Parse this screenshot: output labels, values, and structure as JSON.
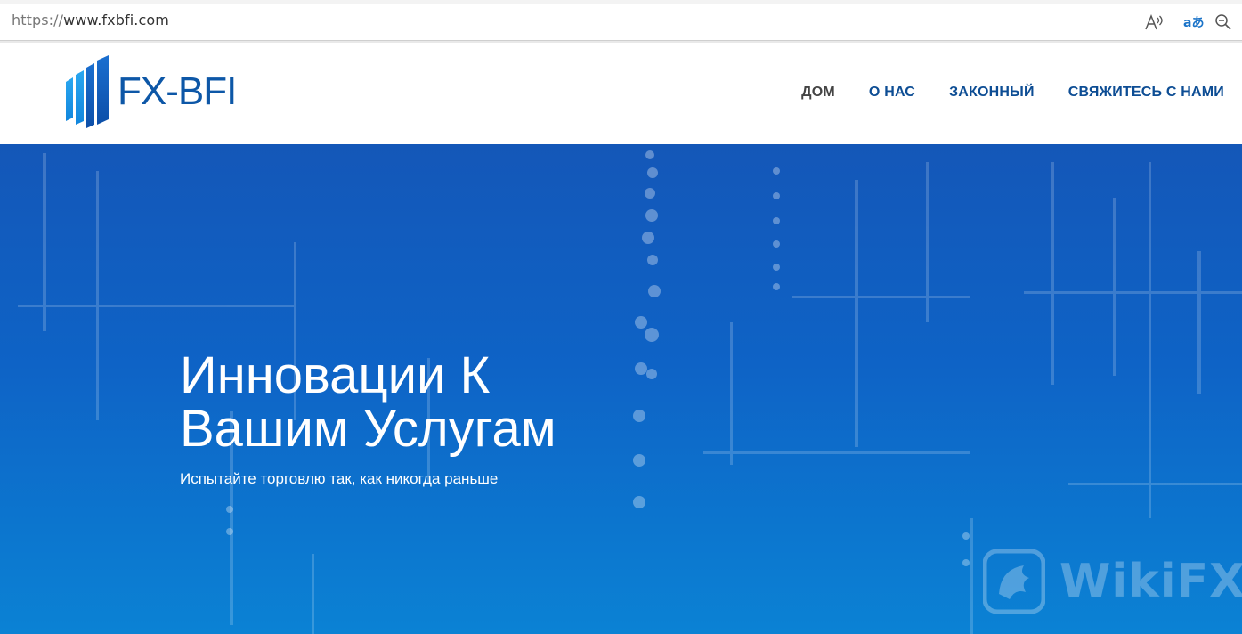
{
  "browser": {
    "url_scheme": "https://",
    "url_host": "www.fxbfi.com",
    "icons": [
      "read-aloud-icon",
      "translate-icon",
      "zoom-out-icon"
    ]
  },
  "header": {
    "logo_text": "FX-BFI",
    "nav": [
      {
        "label": "ДОМ",
        "active": true
      },
      {
        "label": "О НАС"
      },
      {
        "label": "ЗАКОННЫЙ"
      },
      {
        "label": "СВЯЖИТЕСЬ С НАМИ"
      }
    ]
  },
  "hero": {
    "title_line1": "Инновации К",
    "title_line2": "Вашим Услугам",
    "subtitle": "Испытайте торговлю так, как никогда раньше"
  },
  "watermark": {
    "text": "WikiFX"
  },
  "colors": {
    "brand": "#0d57a7",
    "nav_text": "#0d4d94",
    "hero_top": "#1457b8",
    "hero_bottom": "#0b82d4"
  }
}
